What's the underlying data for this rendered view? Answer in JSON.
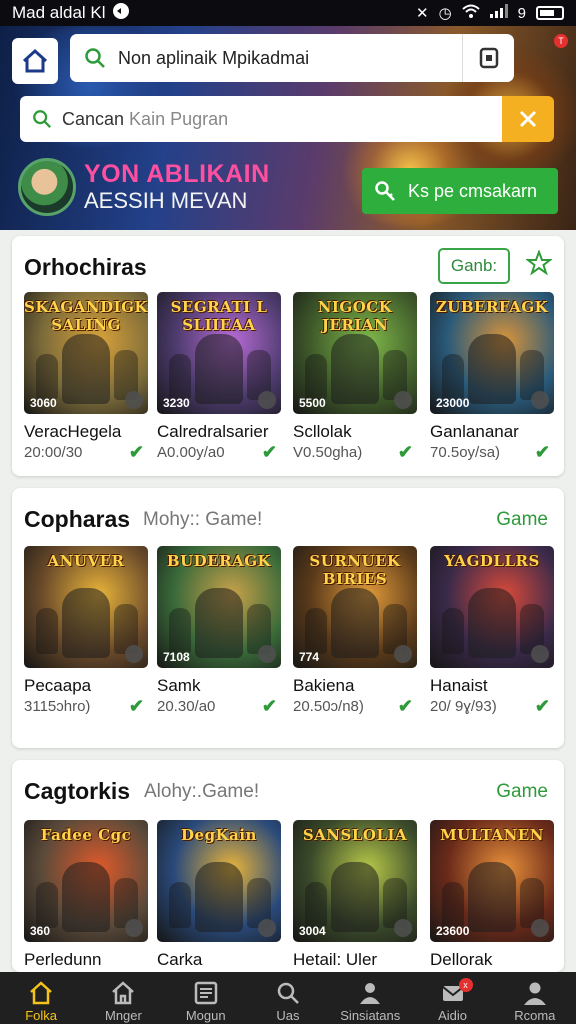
{
  "status_bar": {
    "app_label": "Mad aldal Kl",
    "signal_count": "9"
  },
  "header": {
    "search_top_value": "Non aplinaik Mpikadmai",
    "search_secondary_value": "Cancan",
    "search_secondary_value_light": "Kain Pugran",
    "profile_name": "YON ABLIKAIN",
    "profile_subtitle": "AESSIH MEVAN",
    "cta_label": "Ks pe cmsakarn",
    "notification_badge": "T"
  },
  "sections": [
    {
      "title": "Orhochiras",
      "subtitle": "",
      "button_label": "Ganb:",
      "action_label": "",
      "items": [
        {
          "thumb_title": "SKAGANDIGK SALING",
          "count": "3060",
          "name": "VeracHegela",
          "price": "20:00/30",
          "bg": "#7a6a3a",
          "accent": "#d9a23a"
        },
        {
          "thumb_title": "SEGRATI L SLIIEAA",
          "count": "3230",
          "name": "Calredralsarier",
          "price": "A0.00y/a0",
          "bg": "#4a3a6a",
          "accent": "#b86bd6"
        },
        {
          "thumb_title": "NIGOCK JERIAN",
          "count": "5500",
          "name": "Scllolak",
          "price": "V0.50gha)",
          "bg": "#3f5a2a",
          "accent": "#7fb84a"
        },
        {
          "thumb_title": "ZUBERFAGK",
          "count": "23000",
          "name": "Ganlananar",
          "price": "70.5oy/sa)",
          "bg": "#2a5a7a",
          "accent": "#d9943a"
        }
      ]
    },
    {
      "title": "Copharas",
      "subtitle": "Mohy:: Game!",
      "button_label": "",
      "action_label": "Game",
      "items": [
        {
          "thumb_title": "ANUVER",
          "count": "",
          "name": "Pecaapa",
          "price": "3115ɔhro)",
          "bg": "#6a4a2a",
          "accent": "#e8b43a"
        },
        {
          "thumb_title": "BUDERAGK",
          "count": "7108",
          "name": "Samk",
          "price": "20.30/a0",
          "bg": "#3a6a3a",
          "accent": "#c9a24a"
        },
        {
          "thumb_title": "SURNUEK BIRIES",
          "count": "774",
          "name": "Bakiena",
          "price": "20.50ɔ/n8)",
          "bg": "#5a3a1a",
          "accent": "#e09a3a"
        },
        {
          "thumb_title": "YAGDLLRS",
          "count": "",
          "name": "Hanaist",
          "price": "20/ 9ɣ/93)",
          "bg": "#3a2a4a",
          "accent": "#d94a3a"
        }
      ]
    },
    {
      "title": "Cagtorkis",
      "subtitle": "Alohy:.Game!",
      "button_label": "",
      "action_label": "Game",
      "items": [
        {
          "thumb_title": "Fadee Cgc",
          "count": "360",
          "name": "Perledunn",
          "price": "",
          "bg": "#5a4a3a",
          "accent": "#e05a2a"
        },
        {
          "thumb_title": "DegKain",
          "count": "",
          "name": "Carka",
          "price": "",
          "bg": "#2a4a7a",
          "accent": "#e8b43a"
        },
        {
          "thumb_title": "SANSLOLIA",
          "count": "3004",
          "name": "Hetail: Uler",
          "price": "",
          "bg": "#3a4a2a",
          "accent": "#b8c94a"
        },
        {
          "thumb_title": "MULTANEN",
          "count": "23600",
          "name": "Dellorak",
          "price": "",
          "bg": "#6a2a1a",
          "accent": "#e8903a"
        }
      ]
    }
  ],
  "bottom_nav": [
    {
      "label": "Folka",
      "icon": "home-icon",
      "active": true
    },
    {
      "label": "Mnger",
      "icon": "store-icon",
      "active": false
    },
    {
      "label": "Mogun",
      "icon": "list-icon",
      "active": false
    },
    {
      "label": "Uas",
      "icon": "search-icon",
      "active": false
    },
    {
      "label": "Sinsiatans",
      "icon": "person-icon",
      "active": false
    },
    {
      "label": "Aidio",
      "icon": "mail-icon",
      "active": false,
      "badge": "x"
    },
    {
      "label": "Rcoma",
      "icon": "profile-icon",
      "active": false
    }
  ],
  "colors": {
    "accent_green": "#2eae3c",
    "accent_yellow": "#f4b020",
    "nav_active": "#f4c31a"
  }
}
